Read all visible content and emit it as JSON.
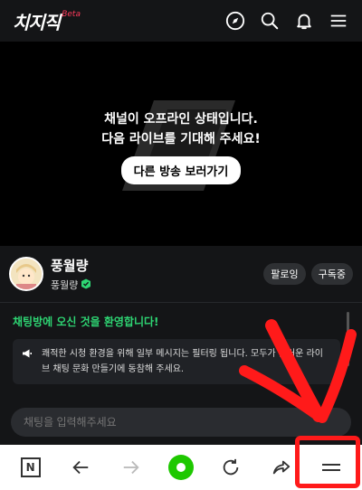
{
  "app": {
    "logo_text": "치지직",
    "logo_badge": "Beta"
  },
  "topbar": {
    "icons": [
      "compass-icon",
      "search-icon",
      "bell-icon",
      "menu-icon"
    ]
  },
  "player": {
    "offline_line1": "채널이 오프라인 상태입니다.",
    "offline_line2": "다음 라이브를 기대해 주세요!",
    "other_button": "다른 방송 보러가기"
  },
  "channel": {
    "title": "풍월량",
    "name": "풍월량",
    "follow_label": "팔로잉",
    "subscribe_label": "구독중"
  },
  "chat": {
    "welcome": "채팅방에 오신 것을 환영합니다!",
    "notice": "쾌적한 시청 환경을 위해 일부 메시지는 필터링 됩니다. 모두가 즐거운 라이브 채팅 문화 만들기에 동참해 주세요.",
    "input_placeholder": "채팅을 입력해주세요"
  },
  "bottombar": {
    "n_label": "N",
    "icons": [
      "naver-n-icon",
      "back-arrow-icon",
      "forward-arrow-icon",
      "home-icon",
      "refresh-icon",
      "share-icon",
      "menu-icon"
    ]
  },
  "colors": {
    "accent_green": "#2ed573",
    "naver_green": "#1ec800",
    "annotation_red": "#ff1a1a"
  }
}
